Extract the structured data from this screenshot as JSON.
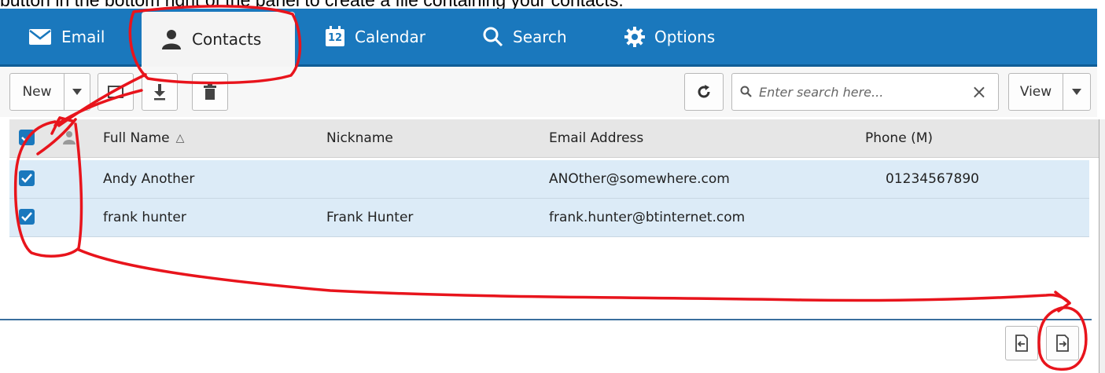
{
  "caption": "button in the bottom right of the panel to create a file containing your contacts.",
  "nav": {
    "tabs": [
      {
        "label": "Email",
        "icon": "envelope-icon"
      },
      {
        "label": "Contacts",
        "icon": "person-icon"
      },
      {
        "label": "Calendar",
        "icon": "calendar-icon",
        "badge": "12"
      },
      {
        "label": "Search",
        "icon": "magnifier-icon"
      },
      {
        "label": "Options",
        "icon": "gear-icon"
      }
    ],
    "active": "Contacts"
  },
  "toolbar": {
    "new_label": "New",
    "view_label": "View",
    "search_placeholder": "Enter search here...",
    "clear_symbol": "×"
  },
  "table": {
    "headers": [
      "Full Name",
      "Nickname",
      "Email Address",
      "Phone (M)"
    ],
    "sort_indicator": "△",
    "rows": [
      {
        "full_name": "Andy Another",
        "nickname": "",
        "email": "ANOther@somewhere.com",
        "phone": "01234567890",
        "checked": true
      },
      {
        "full_name": "frank hunter",
        "nickname": "Frank Hunter",
        "email": "frank.hunter@btinternet.com",
        "phone": "",
        "checked": true
      }
    ]
  },
  "colors": {
    "navbar": "#1a78bd",
    "selected_row": "#dcebf7",
    "annotation": "#e8141c"
  }
}
